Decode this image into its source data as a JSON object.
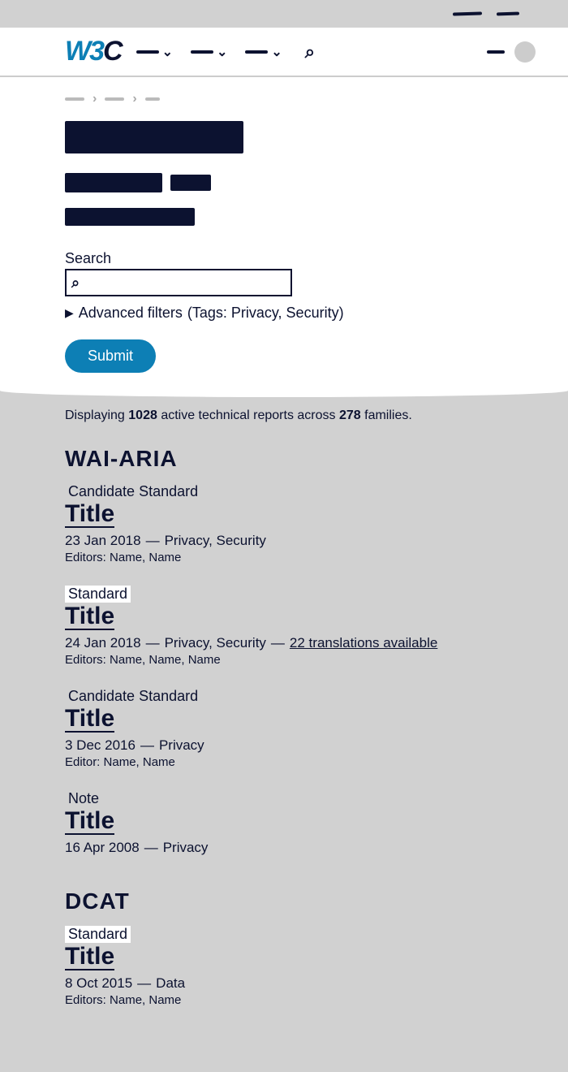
{
  "logo": {
    "part1": "W3",
    "part2": "C"
  },
  "search": {
    "label": "Search",
    "placeholder": ""
  },
  "advanced_filters": {
    "label": "Advanced filters",
    "detail": "(Tags: Privacy, Security)"
  },
  "submit_label": "Submit",
  "summary": {
    "prefix": "Displaying",
    "count_reports": "1028",
    "mid": "active technical reports across",
    "count_families": "278",
    "suffix": "families."
  },
  "families": [
    {
      "name": "WAI-ARIA",
      "reports": [
        {
          "status": "Candidate Standard",
          "highlight": false,
          "title": "Title",
          "date": "23 Jan 2018",
          "tags": "Privacy, Security",
          "translations": "",
          "editors": "Editors: Name, Name"
        },
        {
          "status": "Standard",
          "highlight": true,
          "title": "Title",
          "date": "24 Jan 2018",
          "tags": "Privacy, Security",
          "translations": "22 translations available",
          "editors": "Editors: Name, Name, Name"
        },
        {
          "status": "Candidate Standard",
          "highlight": false,
          "title": "Title",
          "date": "3 Dec 2016",
          "tags": "Privacy",
          "translations": "",
          "editors": "Editor: Name, Name"
        },
        {
          "status": "Note",
          "highlight": false,
          "title": "Title",
          "date": "16 Apr 2008",
          "tags": "Privacy",
          "translations": "",
          "editors": ""
        }
      ]
    },
    {
      "name": "DCAT",
      "reports": [
        {
          "status": "Standard",
          "highlight": true,
          "title": "Title",
          "date": "8 Oct 2015",
          "tags": "Data",
          "translations": "",
          "editors": "Editors: Name, Name"
        }
      ]
    }
  ]
}
